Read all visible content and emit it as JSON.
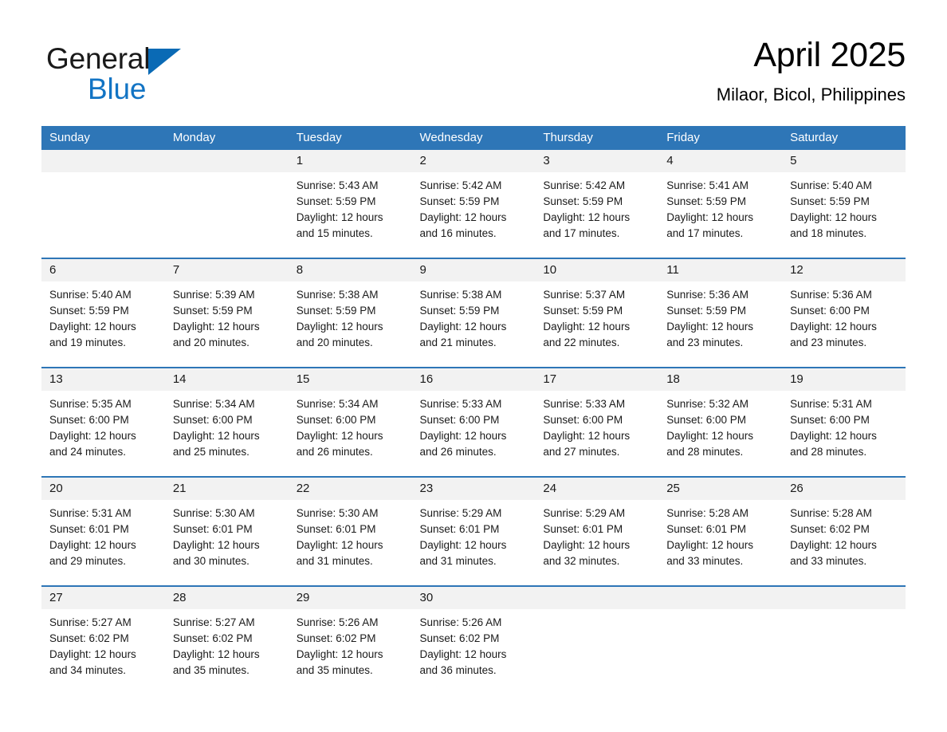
{
  "logo": {
    "word1": "General",
    "word2": "Blue",
    "triangle_color": "#0a6ab5",
    "blue_text_color": "#1274c4"
  },
  "header": {
    "title": "April 2025",
    "subtitle": "Milaor, Bicol, Philippines"
  },
  "theme": {
    "header_blue": "#2e76b7",
    "day_band_gray": "#f2f2f2",
    "text_black": "#1a1a1a"
  },
  "weekdays": [
    "Sunday",
    "Monday",
    "Tuesday",
    "Wednesday",
    "Thursday",
    "Friday",
    "Saturday"
  ],
  "labels": {
    "sunrise": "Sunrise:",
    "sunset": "Sunset:",
    "daylight": "Daylight:"
  },
  "weeks": [
    [
      {
        "day": "",
        "sunrise": "",
        "sunset": "",
        "daylight_1": "",
        "daylight_2": ""
      },
      {
        "day": "",
        "sunrise": "",
        "sunset": "",
        "daylight_1": "",
        "daylight_2": ""
      },
      {
        "day": "1",
        "sunrise": "Sunrise: 5:43 AM",
        "sunset": "Sunset: 5:59 PM",
        "daylight_1": "Daylight: 12 hours",
        "daylight_2": "and 15 minutes."
      },
      {
        "day": "2",
        "sunrise": "Sunrise: 5:42 AM",
        "sunset": "Sunset: 5:59 PM",
        "daylight_1": "Daylight: 12 hours",
        "daylight_2": "and 16 minutes."
      },
      {
        "day": "3",
        "sunrise": "Sunrise: 5:42 AM",
        "sunset": "Sunset: 5:59 PM",
        "daylight_1": "Daylight: 12 hours",
        "daylight_2": "and 17 minutes."
      },
      {
        "day": "4",
        "sunrise": "Sunrise: 5:41 AM",
        "sunset": "Sunset: 5:59 PM",
        "daylight_1": "Daylight: 12 hours",
        "daylight_2": "and 17 minutes."
      },
      {
        "day": "5",
        "sunrise": "Sunrise: 5:40 AM",
        "sunset": "Sunset: 5:59 PM",
        "daylight_1": "Daylight: 12 hours",
        "daylight_2": "and 18 minutes."
      }
    ],
    [
      {
        "day": "6",
        "sunrise": "Sunrise: 5:40 AM",
        "sunset": "Sunset: 5:59 PM",
        "daylight_1": "Daylight: 12 hours",
        "daylight_2": "and 19 minutes."
      },
      {
        "day": "7",
        "sunrise": "Sunrise: 5:39 AM",
        "sunset": "Sunset: 5:59 PM",
        "daylight_1": "Daylight: 12 hours",
        "daylight_2": "and 20 minutes."
      },
      {
        "day": "8",
        "sunrise": "Sunrise: 5:38 AM",
        "sunset": "Sunset: 5:59 PM",
        "daylight_1": "Daylight: 12 hours",
        "daylight_2": "and 20 minutes."
      },
      {
        "day": "9",
        "sunrise": "Sunrise: 5:38 AM",
        "sunset": "Sunset: 5:59 PM",
        "daylight_1": "Daylight: 12 hours",
        "daylight_2": "and 21 minutes."
      },
      {
        "day": "10",
        "sunrise": "Sunrise: 5:37 AM",
        "sunset": "Sunset: 5:59 PM",
        "daylight_1": "Daylight: 12 hours",
        "daylight_2": "and 22 minutes."
      },
      {
        "day": "11",
        "sunrise": "Sunrise: 5:36 AM",
        "sunset": "Sunset: 5:59 PM",
        "daylight_1": "Daylight: 12 hours",
        "daylight_2": "and 23 minutes."
      },
      {
        "day": "12",
        "sunrise": "Sunrise: 5:36 AM",
        "sunset": "Sunset: 6:00 PM",
        "daylight_1": "Daylight: 12 hours",
        "daylight_2": "and 23 minutes."
      }
    ],
    [
      {
        "day": "13",
        "sunrise": "Sunrise: 5:35 AM",
        "sunset": "Sunset: 6:00 PM",
        "daylight_1": "Daylight: 12 hours",
        "daylight_2": "and 24 minutes."
      },
      {
        "day": "14",
        "sunrise": "Sunrise: 5:34 AM",
        "sunset": "Sunset: 6:00 PM",
        "daylight_1": "Daylight: 12 hours",
        "daylight_2": "and 25 minutes."
      },
      {
        "day": "15",
        "sunrise": "Sunrise: 5:34 AM",
        "sunset": "Sunset: 6:00 PM",
        "daylight_1": "Daylight: 12 hours",
        "daylight_2": "and 26 minutes."
      },
      {
        "day": "16",
        "sunrise": "Sunrise: 5:33 AM",
        "sunset": "Sunset: 6:00 PM",
        "daylight_1": "Daylight: 12 hours",
        "daylight_2": "and 26 minutes."
      },
      {
        "day": "17",
        "sunrise": "Sunrise: 5:33 AM",
        "sunset": "Sunset: 6:00 PM",
        "daylight_1": "Daylight: 12 hours",
        "daylight_2": "and 27 minutes."
      },
      {
        "day": "18",
        "sunrise": "Sunrise: 5:32 AM",
        "sunset": "Sunset: 6:00 PM",
        "daylight_1": "Daylight: 12 hours",
        "daylight_2": "and 28 minutes."
      },
      {
        "day": "19",
        "sunrise": "Sunrise: 5:31 AM",
        "sunset": "Sunset: 6:00 PM",
        "daylight_1": "Daylight: 12 hours",
        "daylight_2": "and 28 minutes."
      }
    ],
    [
      {
        "day": "20",
        "sunrise": "Sunrise: 5:31 AM",
        "sunset": "Sunset: 6:01 PM",
        "daylight_1": "Daylight: 12 hours",
        "daylight_2": "and 29 minutes."
      },
      {
        "day": "21",
        "sunrise": "Sunrise: 5:30 AM",
        "sunset": "Sunset: 6:01 PM",
        "daylight_1": "Daylight: 12 hours",
        "daylight_2": "and 30 minutes."
      },
      {
        "day": "22",
        "sunrise": "Sunrise: 5:30 AM",
        "sunset": "Sunset: 6:01 PM",
        "daylight_1": "Daylight: 12 hours",
        "daylight_2": "and 31 minutes."
      },
      {
        "day": "23",
        "sunrise": "Sunrise: 5:29 AM",
        "sunset": "Sunset: 6:01 PM",
        "daylight_1": "Daylight: 12 hours",
        "daylight_2": "and 31 minutes."
      },
      {
        "day": "24",
        "sunrise": "Sunrise: 5:29 AM",
        "sunset": "Sunset: 6:01 PM",
        "daylight_1": "Daylight: 12 hours",
        "daylight_2": "and 32 minutes."
      },
      {
        "day": "25",
        "sunrise": "Sunrise: 5:28 AM",
        "sunset": "Sunset: 6:01 PM",
        "daylight_1": "Daylight: 12 hours",
        "daylight_2": "and 33 minutes."
      },
      {
        "day": "26",
        "sunrise": "Sunrise: 5:28 AM",
        "sunset": "Sunset: 6:02 PM",
        "daylight_1": "Daylight: 12 hours",
        "daylight_2": "and 33 minutes."
      }
    ],
    [
      {
        "day": "27",
        "sunrise": "Sunrise: 5:27 AM",
        "sunset": "Sunset: 6:02 PM",
        "daylight_1": "Daylight: 12 hours",
        "daylight_2": "and 34 minutes."
      },
      {
        "day": "28",
        "sunrise": "Sunrise: 5:27 AM",
        "sunset": "Sunset: 6:02 PM",
        "daylight_1": "Daylight: 12 hours",
        "daylight_2": "and 35 minutes."
      },
      {
        "day": "29",
        "sunrise": "Sunrise: 5:26 AM",
        "sunset": "Sunset: 6:02 PM",
        "daylight_1": "Daylight: 12 hours",
        "daylight_2": "and 35 minutes."
      },
      {
        "day": "30",
        "sunrise": "Sunrise: 5:26 AM",
        "sunset": "Sunset: 6:02 PM",
        "daylight_1": "Daylight: 12 hours",
        "daylight_2": "and 36 minutes."
      },
      {
        "day": "",
        "sunrise": "",
        "sunset": "",
        "daylight_1": "",
        "daylight_2": ""
      },
      {
        "day": "",
        "sunrise": "",
        "sunset": "",
        "daylight_1": "",
        "daylight_2": ""
      },
      {
        "day": "",
        "sunrise": "",
        "sunset": "",
        "daylight_1": "",
        "daylight_2": ""
      }
    ]
  ]
}
